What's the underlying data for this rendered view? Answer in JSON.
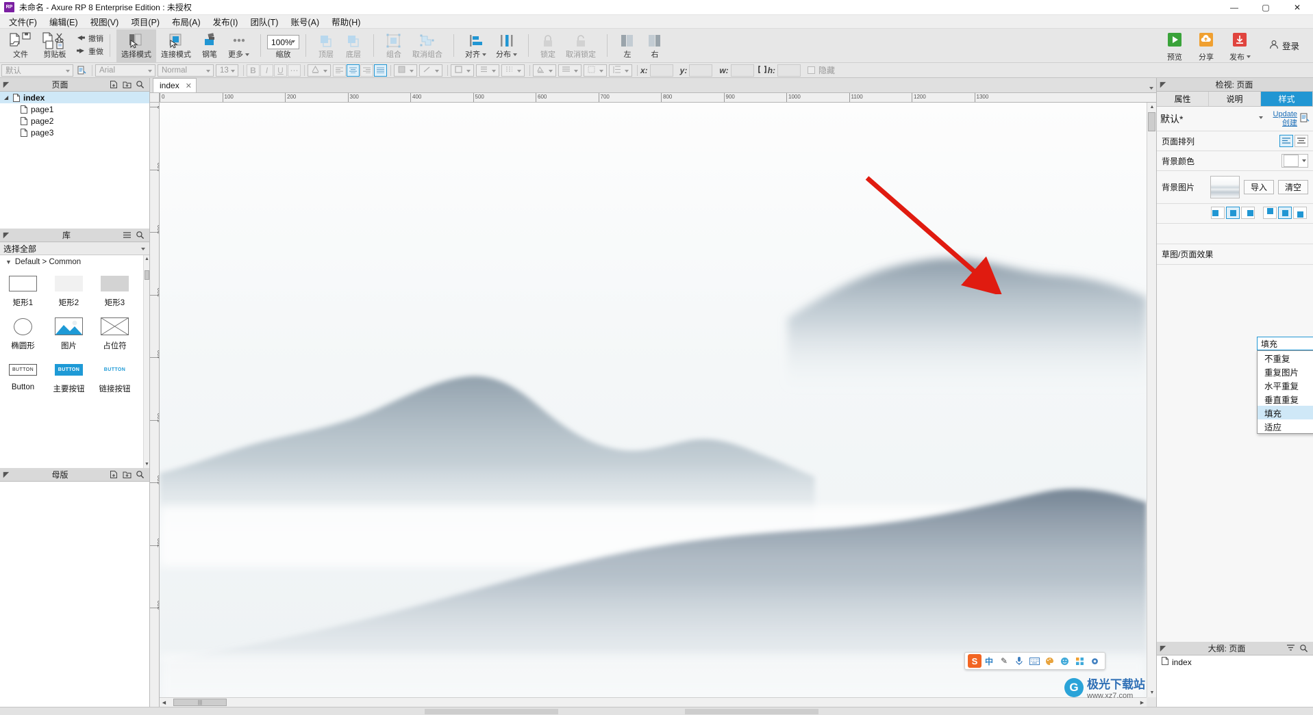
{
  "window": {
    "app_icon": "RP",
    "title": "未命名 - Axure RP 8 Enterprise Edition : 未授权",
    "minimize": "—",
    "maximize": "▢",
    "close": "✕"
  },
  "menubar": {
    "items": [
      {
        "label": "文件(F)"
      },
      {
        "label": "编辑(E)"
      },
      {
        "label": "视图(V)"
      },
      {
        "label": "项目(P)"
      },
      {
        "label": "布局(A)"
      },
      {
        "label": "发布(I)"
      },
      {
        "label": "团队(T)"
      },
      {
        "label": "账号(A)"
      },
      {
        "label": "帮助(H)"
      }
    ]
  },
  "toolbar": {
    "groups": [
      {
        "label": "文件",
        "icon": "new-open-file-icon"
      },
      {
        "label": "剪贴板",
        "icon": "clipboard-icon"
      },
      {
        "label": "撤销",
        "icon": "undo-icon"
      },
      {
        "label": "重做",
        "icon": "redo-icon"
      }
    ],
    "modes": [
      {
        "label": "选择模式",
        "icon": "select-mode-icon",
        "active": true
      },
      {
        "label": "连接模式",
        "icon": "connect-mode-icon",
        "active": false
      },
      {
        "label": "钢笔",
        "icon": "pen-icon",
        "active": false
      },
      {
        "label": "更多",
        "icon": "more-dots-icon",
        "active": false
      }
    ],
    "zoom": {
      "label": "缩放",
      "value": "100%"
    },
    "order": [
      {
        "label": "顶层",
        "icon": "bring-to-front-icon"
      },
      {
        "label": "底层",
        "icon": "send-to-back-icon"
      }
    ],
    "grouping": [
      {
        "label": "组合",
        "icon": "group-icon"
      },
      {
        "label": "取消组合",
        "icon": "ungroup-icon"
      }
    ],
    "arrange": [
      {
        "label": "对齐",
        "icon": "align-icon"
      },
      {
        "label": "分布",
        "icon": "distribute-icon"
      }
    ],
    "lock": [
      {
        "label": "锁定",
        "icon": "lock-icon"
      },
      {
        "label": "取消锁定",
        "icon": "unlock-icon"
      }
    ],
    "panels": [
      {
        "label": "左",
        "icon": "left-panel-icon"
      },
      {
        "label": "右",
        "icon": "right-panel-icon"
      }
    ],
    "right_actions": [
      {
        "label": "预览",
        "icon": "preview-play-icon",
        "color": "#3aa33a"
      },
      {
        "label": "分享",
        "icon": "share-cloud-icon",
        "color": "#f0a030"
      },
      {
        "label": "发布",
        "icon": "publish-down-icon",
        "color": "#e0443e"
      }
    ],
    "login": {
      "label": "登录",
      "icon": "user-icon"
    }
  },
  "stylebar": {
    "widget_style": "默认",
    "copy_format_icon": "format-painter-icon",
    "font_family": "Arial",
    "font_weight": "Normal",
    "font_size": "13",
    "bold": "B",
    "italic": "I",
    "underline": "U",
    "more": "⋯",
    "font_color_icon": "font-color-icon",
    "align_left_icon": "align-left-icon",
    "align_center_icon": "align-center-icon",
    "align_right_icon": "align-right-icon",
    "align_justify_icon": "align-justify-icon",
    "fill_icon": "fill-icon",
    "line_icon": "line-icon",
    "line_width_icon": "line-width-icon",
    "line_style_icon": "line-style-icon",
    "border_icon": "border-icon",
    "shadow_icon": "shadow-icon",
    "corner_icon": "corner-icon",
    "line_spacing_icon": "line-spacing-icon",
    "x_label": "x:",
    "x_value": "",
    "y_label": "y:",
    "y_value": "",
    "w_label": "w:",
    "w_value": "",
    "h_label": "h:",
    "h_value": "",
    "lock_ratio_icon": "lock-ratio-icon",
    "hide_label": "隐藏"
  },
  "left_panel": {
    "pages": {
      "title": "页面",
      "add_page_icon": "add-page-icon",
      "add_folder_icon": "add-folder-icon",
      "search_icon": "search-icon",
      "tree": [
        {
          "label": "index",
          "level": 0,
          "selected": true,
          "expanded": true
        },
        {
          "label": "page1",
          "level": 1,
          "selected": false
        },
        {
          "label": "page2",
          "level": 1,
          "selected": false
        },
        {
          "label": "page3",
          "level": 1,
          "selected": false
        }
      ]
    },
    "library": {
      "title": "库",
      "menu_icon": "hamburger-icon",
      "search_icon": "search-icon",
      "selector_value": "选择全部",
      "group_label": "Default > Common",
      "items": [
        {
          "name": "矩形1",
          "icon": "rectangle-outline-icon"
        },
        {
          "name": "矩形2",
          "icon": "rectangle-light-icon"
        },
        {
          "name": "矩形3",
          "icon": "rectangle-gray-icon"
        },
        {
          "name": "椭圆形",
          "icon": "ellipse-icon"
        },
        {
          "name": "图片",
          "icon": "image-icon"
        },
        {
          "name": "占位符",
          "icon": "placeholder-icon"
        },
        {
          "name": "Button",
          "icon": "button-icon",
          "caption": "BUTTON"
        },
        {
          "name": "主要按钮",
          "icon": "primary-button-icon",
          "caption": "BUTTON"
        },
        {
          "name": "链接按钮",
          "icon": "link-button-icon",
          "caption": "BUTTON"
        }
      ]
    },
    "masters": {
      "title": "母版",
      "add_master_icon": "add-master-icon",
      "add_folder_icon": "add-folder-icon",
      "search_icon": "search-icon"
    }
  },
  "canvas": {
    "tab": {
      "label": "index",
      "close": "✕"
    },
    "tab_dropdown_icon": "chevron-down-icon",
    "ruler_h_ticks": [
      "0",
      "100",
      "200",
      "300",
      "400",
      "500",
      "600",
      "700",
      "800",
      "900",
      "1000",
      "1100",
      "1200",
      "1300"
    ],
    "ruler_v_ticks": [
      "0",
      "100",
      "200",
      "300",
      "400",
      "500",
      "600",
      "700",
      "800"
    ],
    "background_description": "ink-wash mountain landscape background image"
  },
  "ime": {
    "logo": "S",
    "items": [
      "中",
      "✎",
      "🎤",
      "⌨",
      "🎨",
      "☺",
      "▦",
      "⚙"
    ]
  },
  "watermark": {
    "glyph": "G",
    "title": "极光下载站",
    "url": "www.xz7.com"
  },
  "right_panel": {
    "inspector_title": "检视: 页面",
    "tabs": [
      {
        "label": "属性",
        "selected": false
      },
      {
        "label": "说明",
        "selected": false
      },
      {
        "label": "样式",
        "selected": true
      }
    ],
    "style_name": "默认*",
    "update_link": "Update",
    "create_link": "创建",
    "manage_icon": "manage-style-icon",
    "rows": {
      "page_align_label": "页面排列",
      "page_align_left_icon": "align-page-left-icon",
      "page_align_center_icon": "align-page-center-icon",
      "bg_color_label": "背景颜色",
      "bg_color_value": "#FFFFFF",
      "bg_image_label": "背景图片",
      "import_button": "导入",
      "clear_button": "清空",
      "sketch_label": "草图/页面效果"
    },
    "tiles_h": [
      {
        "icon": "bg-pos-left-icon",
        "on": false
      },
      {
        "icon": "bg-pos-center-icon",
        "on": true
      },
      {
        "icon": "bg-pos-right-icon",
        "on": false
      }
    ],
    "tiles_v": [
      {
        "icon": "bg-pos-top-icon",
        "on": false
      },
      {
        "icon": "bg-pos-middle-icon",
        "on": true
      },
      {
        "icon": "bg-pos-bottom-icon",
        "on": false
      }
    ],
    "repeat_dropdown": {
      "value": "填充",
      "open": true,
      "options": [
        {
          "label": "不重复",
          "highlighted": false
        },
        {
          "label": "重复图片",
          "highlighted": false
        },
        {
          "label": "水平重复",
          "highlighted": false
        },
        {
          "label": "垂直重复",
          "highlighted": false
        },
        {
          "label": "填充",
          "highlighted": true
        },
        {
          "label": "适应",
          "highlighted": false
        }
      ]
    },
    "outline": {
      "title": "大纲: 页面",
      "filter_icon": "filter-icon",
      "search_icon": "search-icon",
      "items": [
        {
          "label": "index"
        }
      ]
    }
  },
  "annotation": {
    "arrow_color": "#e01b10",
    "target": "repeat-dropdown"
  },
  "colors": {
    "accent": "#2196d3",
    "selection": "#cfe8f7",
    "chrome": "#e7e7e7",
    "panel": "#f2f2f2"
  }
}
